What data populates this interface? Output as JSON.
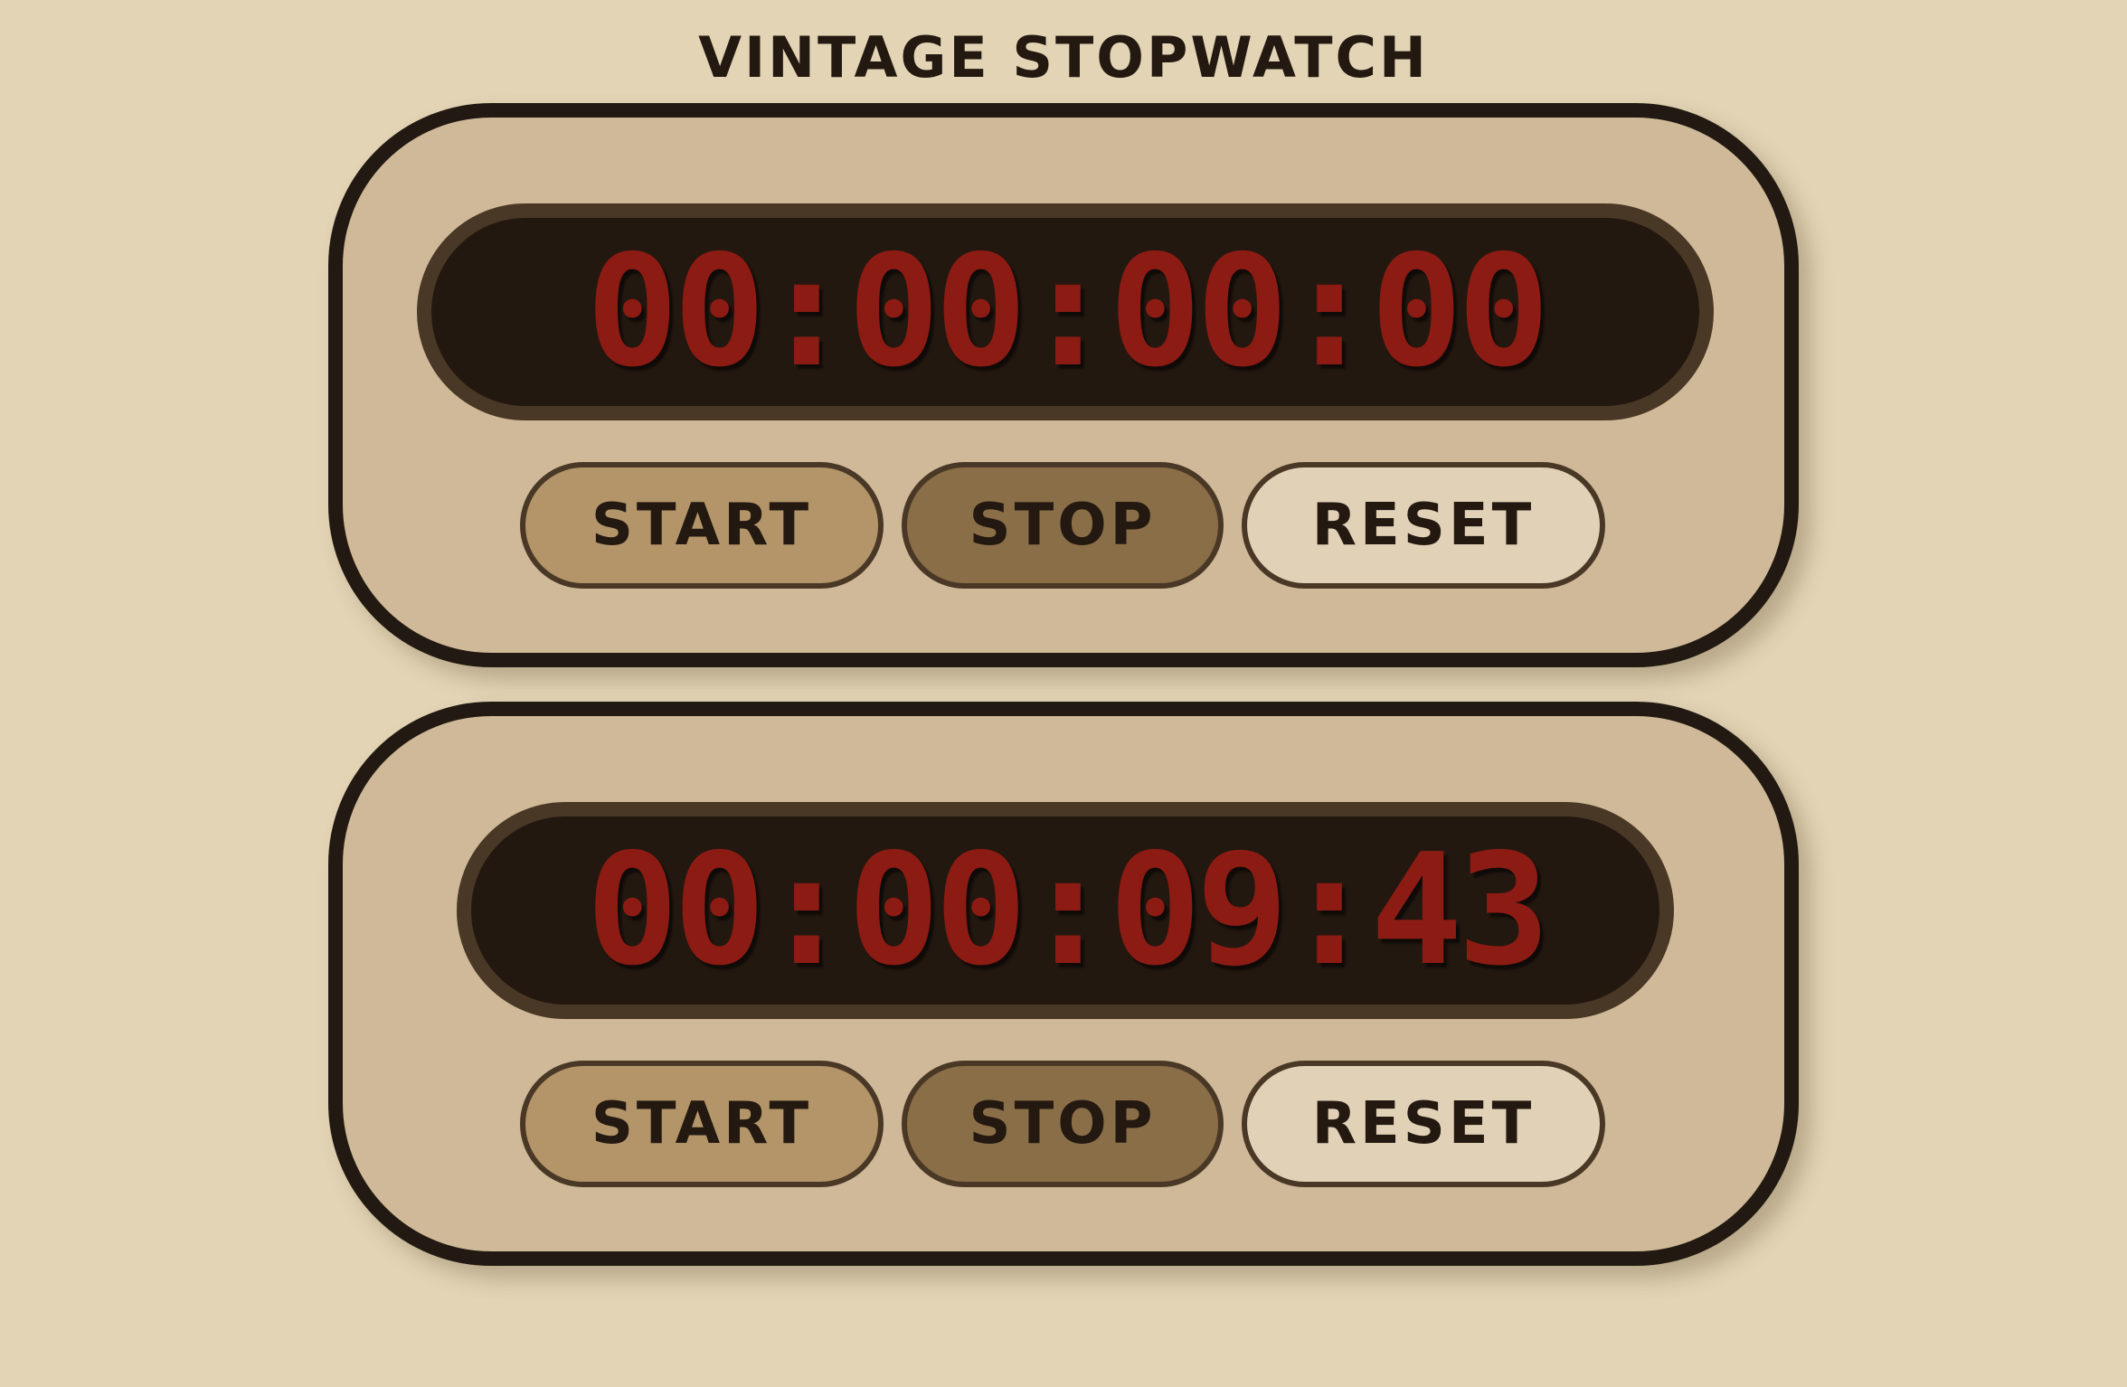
{
  "app": {
    "title": "VINTAGE STOPWATCH"
  },
  "stopwatches": [
    {
      "display": "00:00:00:00",
      "buttons": {
        "start": "START",
        "stop": "STOP",
        "reset": "RESET"
      }
    },
    {
      "display": "00:00:09:43",
      "buttons": {
        "start": "START",
        "stop": "STOP",
        "reset": "RESET"
      }
    }
  ],
  "colors": {
    "page_background": "#e2d4b5",
    "panel_background": "#cfb998",
    "panel_border": "#221a12",
    "display_background": "#231810",
    "display_border": "#4a3826",
    "digit_red": "#8c1b13",
    "start_button": "#b39569",
    "stop_button": "#8a6e47",
    "reset_button": "#e1d1b7",
    "text_dark": "#231911"
  }
}
